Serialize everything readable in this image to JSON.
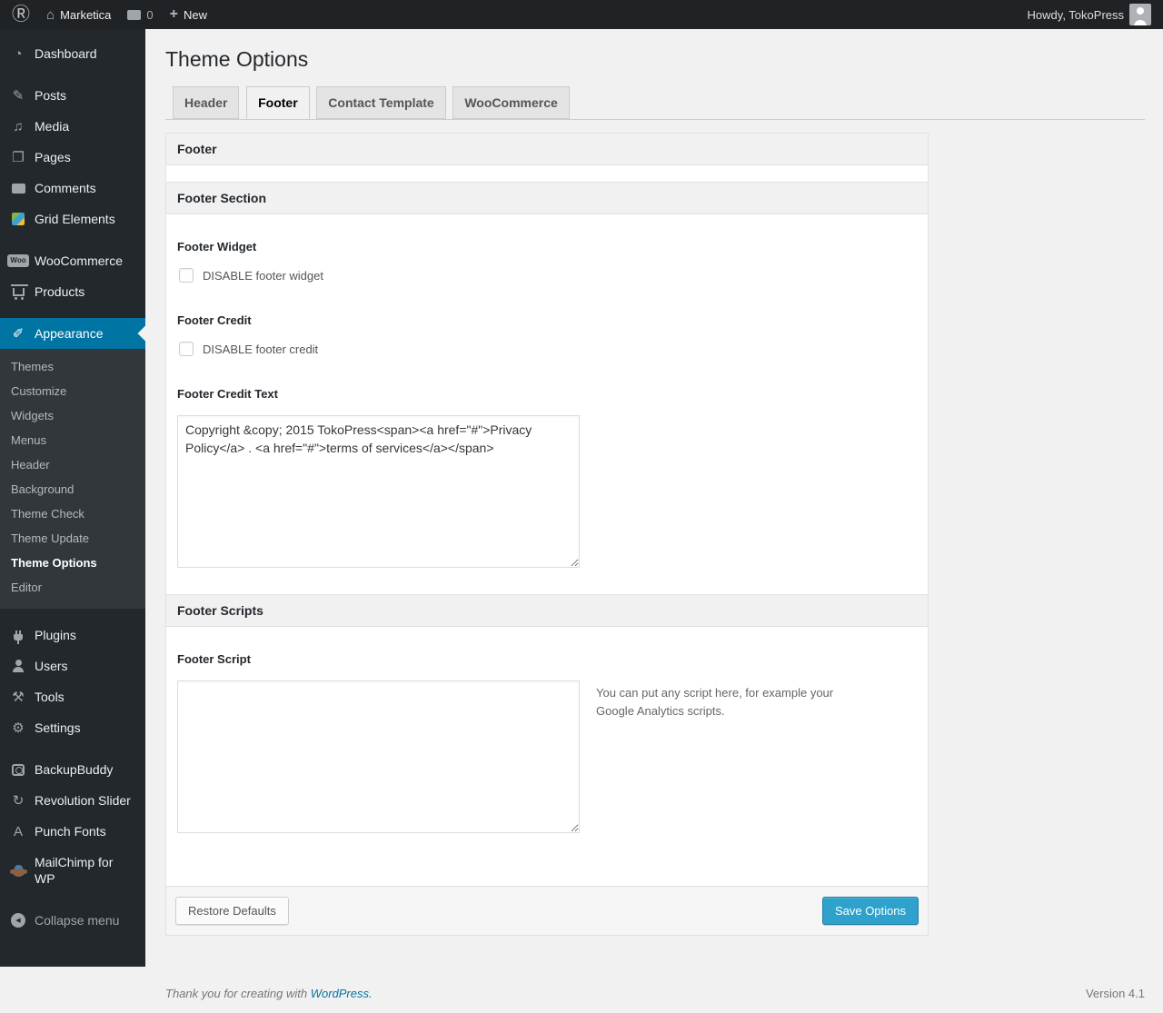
{
  "admin_bar": {
    "site_name": "Marketica",
    "comments_count": "0",
    "new_label": "New",
    "howdy": "Howdy, TokoPress"
  },
  "sidebar": {
    "items": [
      {
        "label": "Dashboard"
      },
      {
        "label": "Posts"
      },
      {
        "label": "Media"
      },
      {
        "label": "Pages"
      },
      {
        "label": "Comments"
      },
      {
        "label": "Grid Elements"
      },
      {
        "label": "WooCommerce"
      },
      {
        "label": "Products"
      },
      {
        "label": "Appearance"
      },
      {
        "label": "Plugins"
      },
      {
        "label": "Users"
      },
      {
        "label": "Tools"
      },
      {
        "label": "Settings"
      },
      {
        "label": "BackupBuddy"
      },
      {
        "label": "Revolution Slider"
      },
      {
        "label": "Punch Fonts"
      },
      {
        "label": "MailChimp for WP"
      },
      {
        "label": "Collapse menu"
      }
    ],
    "woo_badge": "Woo",
    "punch_fonts_glyph": "A",
    "appearance_submenu": [
      {
        "label": "Themes"
      },
      {
        "label": "Customize"
      },
      {
        "label": "Widgets"
      },
      {
        "label": "Menus"
      },
      {
        "label": "Header"
      },
      {
        "label": "Background"
      },
      {
        "label": "Theme Check"
      },
      {
        "label": "Theme Update"
      },
      {
        "label": "Theme Options"
      },
      {
        "label": "Editor"
      }
    ]
  },
  "page": {
    "title": "Theme Options",
    "tabs": [
      {
        "label": "Header"
      },
      {
        "label": "Footer"
      },
      {
        "label": "Contact Template"
      },
      {
        "label": "WooCommerce"
      }
    ],
    "panel": {
      "box_title": "Footer",
      "section1_title": "Footer Section",
      "footer_widget_label": "Footer Widget",
      "footer_widget_checkbox_label": "DISABLE footer widget",
      "footer_credit_label": "Footer Credit",
      "footer_credit_checkbox_label": "DISABLE footer credit",
      "footer_credit_text_label": "Footer Credit Text",
      "footer_credit_text_value": "Copyright &copy; 2015 TokoPress<span><a href=\"#\">Privacy Policy</a> . <a href=\"#\">terms of services</a></span>",
      "section2_title": "Footer Scripts",
      "footer_script_label": "Footer Script",
      "footer_script_value": "",
      "footer_script_help": "You can put any script here, for example your Google Analytics scripts.",
      "restore_button": "Restore Defaults",
      "save_button": "Save Options"
    },
    "footer": {
      "thanks_prefix": "Thank you for creating with ",
      "wordpress_link": "WordPress.",
      "version": "Version 4.1"
    }
  },
  "colors": {
    "accent_blue": "#0074a2",
    "primary_button": "#2ea2cc",
    "admin_bar_bg": "#1f2326",
    "sidebar_bg": "#23282d"
  }
}
